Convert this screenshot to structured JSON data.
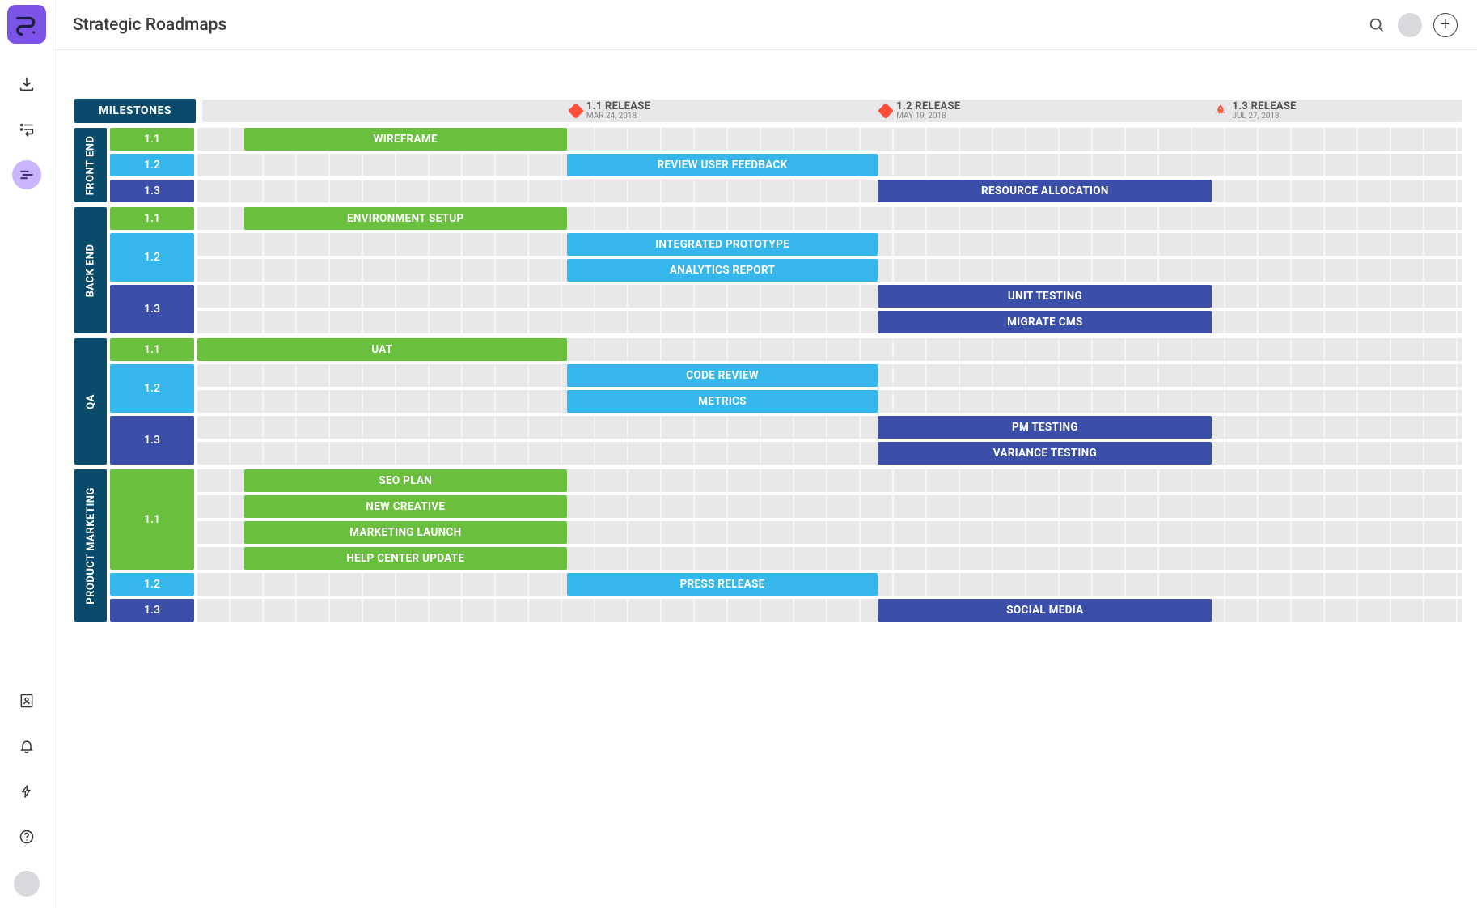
{
  "header": {
    "title": "Strategic Roadmaps"
  },
  "colors": {
    "green": "#6bbf3e",
    "blue": "#35b7ec",
    "navy": "#3b4ea8",
    "teal": "#0a4a6b",
    "purple": "#7b53e6"
  },
  "milestones_label": "MILESTONES",
  "milestones": [
    {
      "title": "1.1 RELEASE",
      "date": "MAR 24, 2018",
      "icon": "diamond",
      "pos": 29.2
    },
    {
      "title": "1.2 RELEASE",
      "date": "MAY 19, 2018",
      "icon": "diamond",
      "pos": 53.8
    },
    {
      "title": "1.3 RELEASE",
      "date": "JUL 27, 2018",
      "icon": "rocket",
      "pos": 80.2
    }
  ],
  "lanes": [
    {
      "name": "FRONT END",
      "subs": [
        {
          "v": "1.1",
          "color": "green",
          "rows": [
            {
              "label": "WIREFRAME",
              "start": 3.7,
              "end": 29.2,
              "color": "green"
            }
          ]
        },
        {
          "v": "1.2",
          "color": "blue",
          "rows": [
            {
              "label": "REVIEW USER FEEDBACK",
              "start": 29.2,
              "end": 53.8,
              "color": "blue"
            }
          ]
        },
        {
          "v": "1.3",
          "color": "navy",
          "rows": [
            {
              "label": "RESOURCE ALLOCATION",
              "start": 53.8,
              "end": 80.2,
              "color": "navy"
            }
          ]
        }
      ]
    },
    {
      "name": "BACK END",
      "subs": [
        {
          "v": "1.1",
          "color": "green",
          "rows": [
            {
              "label": "ENVIRONMENT SETUP",
              "start": 3.7,
              "end": 29.2,
              "color": "green"
            }
          ]
        },
        {
          "v": "1.2",
          "color": "blue",
          "rows": [
            {
              "label": "INTEGRATED PROTOTYPE",
              "start": 29.2,
              "end": 53.8,
              "color": "blue"
            },
            {
              "label": "ANALYTICS REPORT",
              "start": 29.2,
              "end": 53.8,
              "color": "blue"
            }
          ]
        },
        {
          "v": "1.3",
          "color": "navy",
          "rows": [
            {
              "label": "UNIT TESTING",
              "start": 53.8,
              "end": 80.2,
              "color": "navy"
            },
            {
              "label": "MIGRATE CMS",
              "start": 53.8,
              "end": 80.2,
              "color": "navy"
            }
          ]
        }
      ]
    },
    {
      "name": "QA",
      "subs": [
        {
          "v": "1.1",
          "color": "green",
          "rows": [
            {
              "label": "UAT",
              "start": 0,
              "end": 29.2,
              "color": "green"
            }
          ]
        },
        {
          "v": "1.2",
          "color": "blue",
          "rows": [
            {
              "label": "CODE REVIEW",
              "start": 29.2,
              "end": 53.8,
              "color": "blue"
            },
            {
              "label": "METRICS",
              "start": 29.2,
              "end": 53.8,
              "color": "blue"
            }
          ]
        },
        {
          "v": "1.3",
          "color": "navy",
          "rows": [
            {
              "label": "PM TESTING",
              "start": 53.8,
              "end": 80.2,
              "color": "navy"
            },
            {
              "label": "VARIANCE TESTING",
              "start": 53.8,
              "end": 80.2,
              "color": "navy"
            }
          ]
        }
      ]
    },
    {
      "name": "PRODUCT MARKETING",
      "subs": [
        {
          "v": "1.1",
          "color": "green",
          "rows": [
            {
              "label": "SEO PLAN",
              "start": 3.7,
              "end": 29.2,
              "color": "green"
            },
            {
              "label": "NEW CREATIVE",
              "start": 3.7,
              "end": 29.2,
              "color": "green"
            },
            {
              "label": "MARKETING LAUNCH",
              "start": 3.7,
              "end": 29.2,
              "color": "green"
            },
            {
              "label": "HELP CENTER UPDATE",
              "start": 3.7,
              "end": 29.2,
              "color": "green"
            }
          ]
        },
        {
          "v": "1.2",
          "color": "blue",
          "rows": [
            {
              "label": "PRESS RELEASE",
              "start": 29.2,
              "end": 53.8,
              "color": "blue"
            }
          ]
        },
        {
          "v": "1.3",
          "color": "navy",
          "rows": [
            {
              "label": "SOCIAL MEDIA",
              "start": 53.8,
              "end": 80.2,
              "color": "navy"
            }
          ]
        }
      ]
    }
  ],
  "chart_data": {
    "type": "bar",
    "title": "Strategic Roadmaps",
    "milestones": [
      {
        "name": "1.1 RELEASE",
        "date": "MAR 24, 2018"
      },
      {
        "name": "1.2 RELEASE",
        "date": "MAY 19, 2018"
      },
      {
        "name": "1.3 RELEASE",
        "date": "JUL 27, 2018"
      }
    ],
    "series": [
      {
        "lane": "FRONT END",
        "version": "1.1",
        "task": "WIREFRAME",
        "start": 3.7,
        "end": 29.2
      },
      {
        "lane": "FRONT END",
        "version": "1.2",
        "task": "REVIEW USER FEEDBACK",
        "start": 29.2,
        "end": 53.8
      },
      {
        "lane": "FRONT END",
        "version": "1.3",
        "task": "RESOURCE ALLOCATION",
        "start": 53.8,
        "end": 80.2
      },
      {
        "lane": "BACK END",
        "version": "1.1",
        "task": "ENVIRONMENT SETUP",
        "start": 3.7,
        "end": 29.2
      },
      {
        "lane": "BACK END",
        "version": "1.2",
        "task": "INTEGRATED PROTOTYPE",
        "start": 29.2,
        "end": 53.8
      },
      {
        "lane": "BACK END",
        "version": "1.2",
        "task": "ANALYTICS REPORT",
        "start": 29.2,
        "end": 53.8
      },
      {
        "lane": "BACK END",
        "version": "1.3",
        "task": "UNIT TESTING",
        "start": 53.8,
        "end": 80.2
      },
      {
        "lane": "BACK END",
        "version": "1.3",
        "task": "MIGRATE CMS",
        "start": 53.8,
        "end": 80.2
      },
      {
        "lane": "QA",
        "version": "1.1",
        "task": "UAT",
        "start": 0,
        "end": 29.2
      },
      {
        "lane": "QA",
        "version": "1.2",
        "task": "CODE REVIEW",
        "start": 29.2,
        "end": 53.8
      },
      {
        "lane": "QA",
        "version": "1.2",
        "task": "METRICS",
        "start": 29.2,
        "end": 53.8
      },
      {
        "lane": "QA",
        "version": "1.3",
        "task": "PM TESTING",
        "start": 53.8,
        "end": 80.2
      },
      {
        "lane": "QA",
        "version": "1.3",
        "task": "VARIANCE TESTING",
        "start": 53.8,
        "end": 80.2
      },
      {
        "lane": "PRODUCT MARKETING",
        "version": "1.1",
        "task": "SEO PLAN",
        "start": 3.7,
        "end": 29.2
      },
      {
        "lane": "PRODUCT MARKETING",
        "version": "1.1",
        "task": "NEW CREATIVE",
        "start": 3.7,
        "end": 29.2
      },
      {
        "lane": "PRODUCT MARKETING",
        "version": "1.1",
        "task": "MARKETING LAUNCH",
        "start": 3.7,
        "end": 29.2
      },
      {
        "lane": "PRODUCT MARKETING",
        "version": "1.1",
        "task": "HELP CENTER UPDATE",
        "start": 3.7,
        "end": 29.2
      },
      {
        "lane": "PRODUCT MARKETING",
        "version": "1.2",
        "task": "PRESS RELEASE",
        "start": 29.2,
        "end": 53.8
      },
      {
        "lane": "PRODUCT MARKETING",
        "version": "1.3",
        "task": "SOCIAL MEDIA",
        "start": 53.8,
        "end": 80.2
      }
    ],
    "xunit": "percent-of-timeline",
    "legend": {
      "1.1": "green",
      "1.2": "blue",
      "1.3": "navy"
    }
  }
}
